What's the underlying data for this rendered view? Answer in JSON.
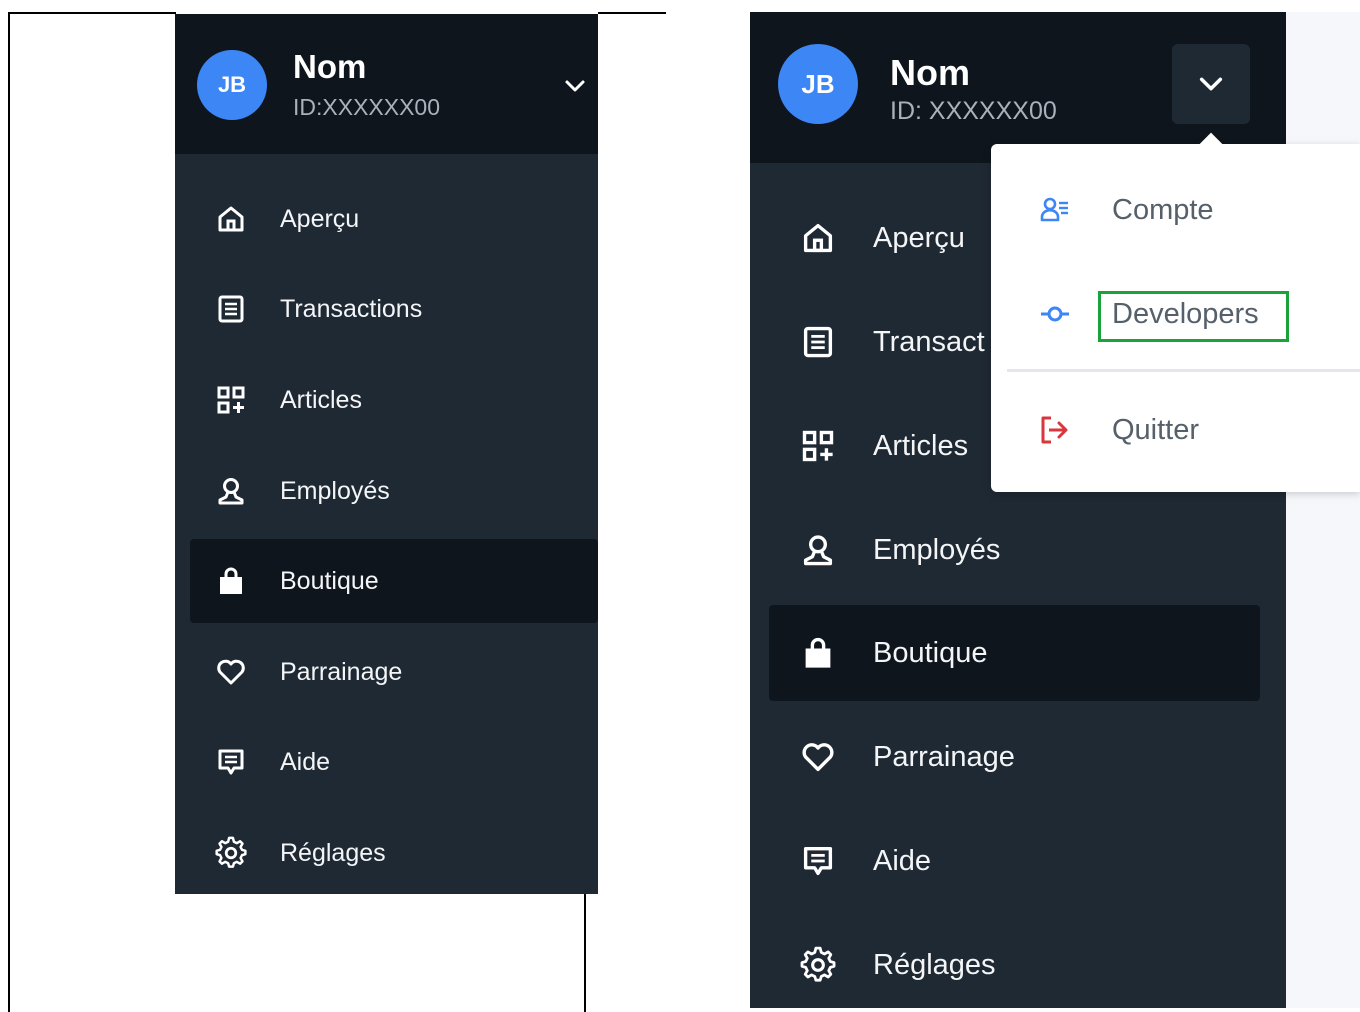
{
  "user": {
    "initials": "JB",
    "name": "Nom",
    "id_left": "ID:XXXXXX00",
    "id_right": "ID: XXXXXX00"
  },
  "nav": {
    "items": [
      {
        "label": "Aperçu",
        "icon": "home-icon"
      },
      {
        "label": "Transactions",
        "icon": "receipt-icon"
      },
      {
        "label": "Articles",
        "icon": "grid-plus-icon"
      },
      {
        "label": "Employés",
        "icon": "person-icon"
      },
      {
        "label": "Boutique",
        "icon": "shopping-bag-icon",
        "active": true
      },
      {
        "label": "Parrainage",
        "icon": "heart-icon"
      },
      {
        "label": "Aide",
        "icon": "chat-icon"
      },
      {
        "label": "Réglages",
        "icon": "gear-icon"
      }
    ],
    "truncated_transactions": "Transact"
  },
  "dropdown": {
    "items": [
      {
        "label": "Compte",
        "icon": "account-icon"
      },
      {
        "label": "Developers",
        "icon": "api-icon"
      },
      {
        "label": "Quitter",
        "icon": "logout-icon"
      }
    ]
  },
  "colors": {
    "sidebar_bg": "#1f2933",
    "header_bg": "#0f151d",
    "avatar": "#3d86f5",
    "highlight": "#1aa33b",
    "logout": "#d9363e",
    "accent_icon": "#3d86f5"
  }
}
